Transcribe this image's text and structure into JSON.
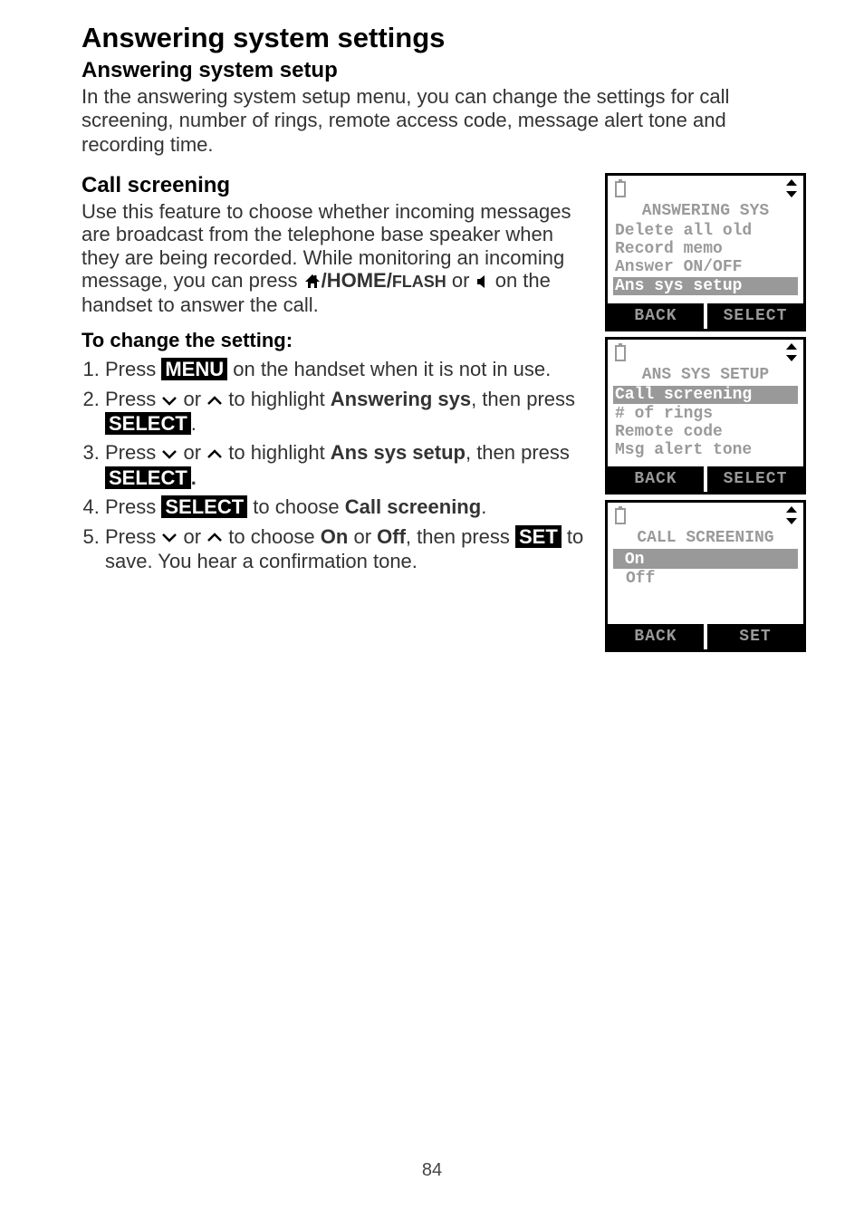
{
  "page_number": "84",
  "heading": "Answering system settings",
  "subheading": "Answering system setup",
  "intro": "In the answering system setup menu, you can change the settings for call screening, number of rings, remote access code, message alert tone and recording time.",
  "call_screening_heading": "Call screening",
  "call_screening_para_1": "Use this feature to choose whether incoming messages are broadcast from the telephone base speaker when they are being recorded. While monitoring an incoming message, you can press ",
  "home_flash_label": "/HOME/",
  "flash_small": "FLASH",
  "or_text": " or ",
  "call_screening_para_2": " on the handset to answer the call.",
  "to_change_heading": "To change the setting:",
  "steps": {
    "s1a": "Press ",
    "s1_menu": "MENU",
    "s1b": " on the handset when it is not in use.",
    "s2a": "Press ",
    "s2b": " or ",
    "s2c": " to highlight ",
    "s2_bold": "Answering sys",
    "s2d": ", then press ",
    "s2_sel": "SELECT",
    "s2e": ".",
    "s3a": "Press ",
    "s3b": " or ",
    "s3c": " to highlight ",
    "s3_bold": "Ans sys setup",
    "s3d": ", then press ",
    "s3_sel": "SELECT",
    "s3e": ".",
    "s4a": "Press ",
    "s4_sel": "SELECT",
    "s4b": " to choose ",
    "s4_bold": "Call screening",
    "s4c": ".",
    "s5a": "Press ",
    "s5b": " or ",
    "s5c": " to choose ",
    "s5_on": "On",
    "s5_or": " or ",
    "s5_off": "Off",
    "s5d": ", then press ",
    "s5_set": "SET",
    "s5e": " to save. You hear a confirmation tone."
  },
  "lcd1": {
    "title": "ANSWERING SYS",
    "lines": [
      "Delete all old",
      "Record memo",
      "Answer ON/OFF"
    ],
    "selected": "Ans sys setup",
    "soft_left": "BACK",
    "soft_right": "SELECT"
  },
  "lcd2": {
    "title": "ANS SYS SETUP",
    "selected": "Call screening",
    "lines": [
      "# of rings",
      "Remote code",
      "Msg alert tone"
    ],
    "soft_left": "BACK",
    "soft_right": "SELECT"
  },
  "lcd3": {
    "title": "CALL SCREENING",
    "selected": "On",
    "lines": [
      "Off"
    ],
    "soft_left": "BACK",
    "soft_right": "SET"
  }
}
